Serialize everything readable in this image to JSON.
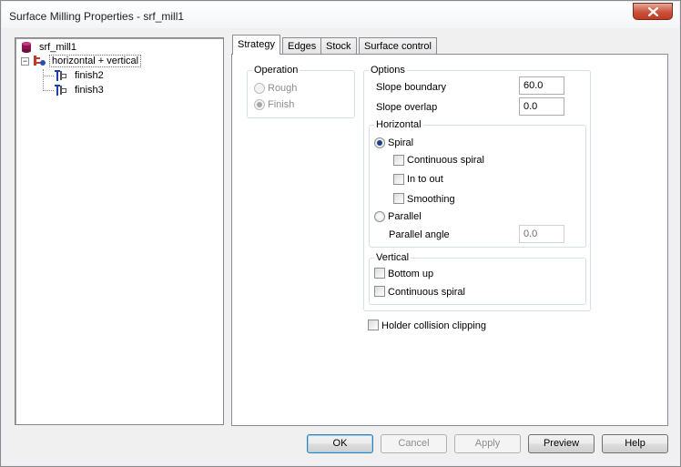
{
  "window": {
    "title": "Surface Milling Properties - srf_mill1"
  },
  "tree": {
    "root": "srf_mill1",
    "child": "horizontal + vertical",
    "leaves": [
      "finish2",
      "finish3"
    ]
  },
  "tabs": [
    {
      "label": "Strategy",
      "active": true
    },
    {
      "label": "Edges",
      "active": false
    },
    {
      "label": "Stock",
      "active": false
    },
    {
      "label": "Surface control",
      "active": false
    }
  ],
  "operation": {
    "title": "Operation",
    "rough": "Rough",
    "finish": "Finish",
    "selected": "Finish"
  },
  "options": {
    "title": "Options",
    "slope_boundary_label": "Slope boundary",
    "slope_boundary_value": "60.0",
    "slope_overlap_label": "Slope overlap",
    "slope_overlap_value": "0.0",
    "horizontal": {
      "title": "Horizontal",
      "spiral": "Spiral",
      "continuous_spiral": "Continuous spiral",
      "in_to_out": "In to out",
      "smoothing": "Smoothing",
      "parallel": "Parallel",
      "parallel_angle_label": "Parallel angle",
      "parallel_angle_value": "0.0"
    },
    "vertical": {
      "title": "Vertical",
      "bottom_up": "Bottom up",
      "continuous_spiral": "Continuous spiral"
    }
  },
  "holder_collision": "Holder collision clipping",
  "buttons": {
    "ok": "OK",
    "cancel": "Cancel",
    "apply": "Apply",
    "preview": "Preview",
    "help": "Help"
  }
}
